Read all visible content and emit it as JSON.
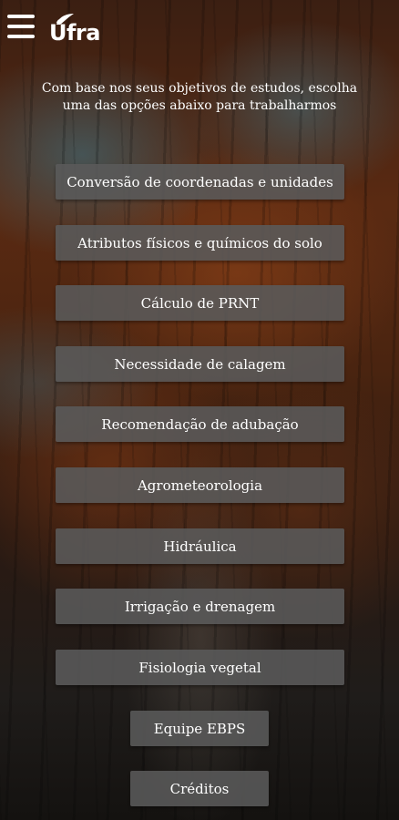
{
  "header": {
    "logo_text": "Úfra",
    "menu_icon": "hamburger-menu-icon"
  },
  "intro": {
    "text": "Com base nos seus objetivos de estudos, escolha uma das opções abaixo para trabalharmos"
  },
  "menu": {
    "items": [
      {
        "label": "Conversão de coordenadas e unidades"
      },
      {
        "label": "Atributos físicos e químicos do solo"
      },
      {
        "label": "Cálculo de PRNT"
      },
      {
        "label": "Necessidade de calagem"
      },
      {
        "label": "Recomendação de adubação"
      },
      {
        "label": "Agrometeorologia"
      },
      {
        "label": "Hidráulica"
      },
      {
        "label": "Irrigação e drenagem"
      },
      {
        "label": "Fisiologia vegetal"
      },
      {
        "label": "Equipe EBPS"
      },
      {
        "label": "Créditos"
      }
    ]
  },
  "colors": {
    "button_bg": "#5a5a5a",
    "text": "#ffffff"
  }
}
